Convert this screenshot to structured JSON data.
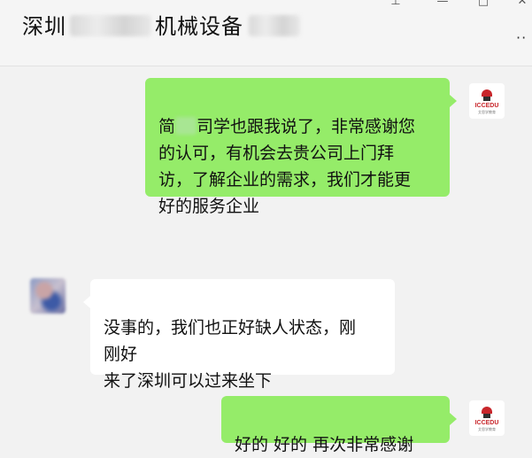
{
  "header": {
    "title_prefix": "深圳",
    "title_middle": "机械设备",
    "title_suffix": "",
    "more_label": "··"
  },
  "window_controls": {
    "pin_glyph": "⊥",
    "minimize_glyph": "—",
    "maximize_glyph": "□",
    "close_glyph": "✕"
  },
  "messages": [
    {
      "side": "right",
      "sender": "self",
      "text_prefix": "简",
      "text": "司学也跟我说了，非常感谢您\n的认可，有机会去贵公司上门拜\n访，了解企业的需求，我们才能更\n好的服务企业"
    },
    {
      "side": "left",
      "sender": "contact",
      "text": "没事的，我们也正好缺人状态，刚\n刚好\n来了深圳可以过来坐下"
    },
    {
      "side": "right",
      "sender": "self",
      "text": "好的 好的  再次非常感谢"
    }
  ],
  "avatars": {
    "self_logo_text": "ICCEDU",
    "self_logo_sub": "艾思学教育"
  },
  "colors": {
    "background": "#f2f2f2",
    "bubble_self": "#95ec69",
    "bubble_other": "#ffffff",
    "logo_red": "#c8262b"
  }
}
